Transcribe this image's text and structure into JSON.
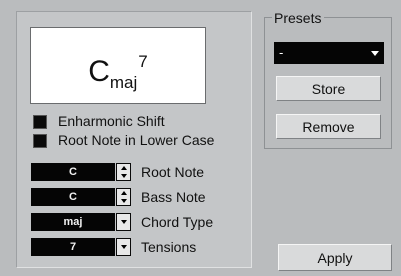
{
  "chord_display": {
    "root": "C",
    "type": "maj",
    "tension": "7"
  },
  "options": {
    "enharmonic_shift": {
      "label": "Enharmonic Shift",
      "checked": true
    },
    "root_lower_case": {
      "label": "Root Note in Lower Case",
      "checked": true
    }
  },
  "fields": {
    "root_note": {
      "value": "C",
      "label": "Root Note"
    },
    "bass_note": {
      "value": "C",
      "label": "Bass Note"
    },
    "chord_type": {
      "value": "maj",
      "label": "Chord Type"
    },
    "tensions": {
      "value": "7",
      "label": "Tensions"
    }
  },
  "presets": {
    "title": "Presets",
    "selected": "-",
    "store_label": "Store",
    "remove_label": "Remove"
  },
  "apply_label": "Apply"
}
